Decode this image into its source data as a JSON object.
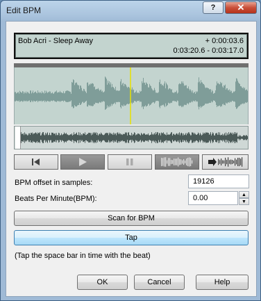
{
  "window": {
    "title": "Edit BPM",
    "help_label": "?",
    "close_label": "✕"
  },
  "display": {
    "song": "Bob Acri - Sleep Away",
    "offset": "+ 0:00:03.6",
    "range": "0:03:20.6 - 0:03:17.0"
  },
  "transport": {
    "prev_icon": "skip-back-icon",
    "play_icon": "play-icon",
    "pause_icon": "pause-icon",
    "wave_icon": "waveform-icon",
    "loop_icon": "waveform-loop-icon"
  },
  "fields": {
    "offset_label": "BPM offset in samples:",
    "offset_value": "19126",
    "bpm_label": "Beats Per Minute(BPM):",
    "bpm_value": "0.00"
  },
  "buttons": {
    "scan": "Scan for BPM",
    "tap": "Tap",
    "ok": "OK",
    "cancel": "Cancel",
    "help": "Help"
  },
  "hint": "(Tap the space bar in time with the beat)",
  "colors": {
    "waveform": "#7f9d99",
    "cursor": "#e6e000",
    "display_bg": "#c3d4cf"
  }
}
